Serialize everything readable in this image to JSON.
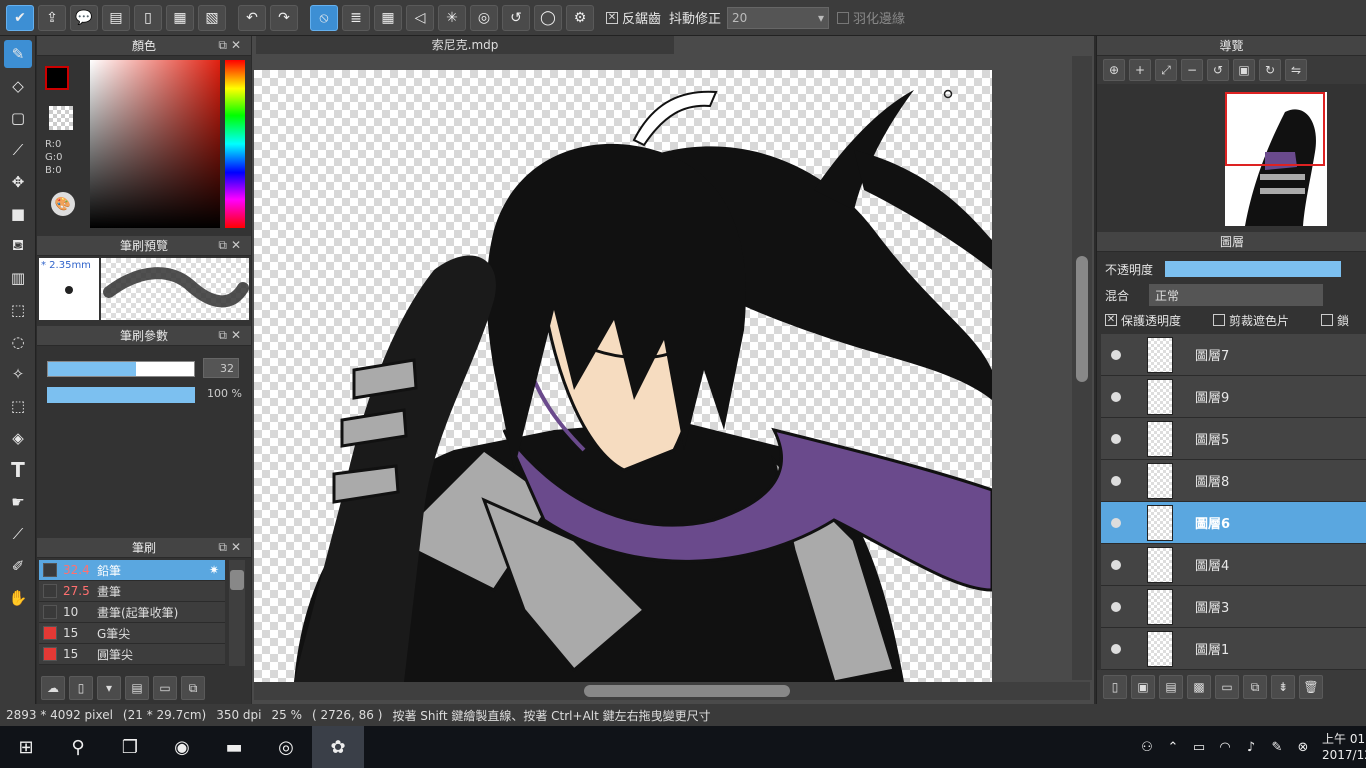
{
  "toolbar": {
    "antialias_label": "反鋸齒",
    "stabilizer_label": "抖動修正",
    "stabilizer_value": "20",
    "feather_label": "羽化邊緣"
  },
  "panels": {
    "color_title": "顏色",
    "rgb": {
      "r": "R:0",
      "g": "G:0",
      "b": "B:0"
    },
    "brush_preview_title": "筆刷預覽",
    "brush_size_text": "* 2.35mm",
    "brush_params_title": "筆刷參數",
    "size_value": "32",
    "size_fill": 0.6,
    "opacity_value": "100 %",
    "opacity_fill": 1.0,
    "brush_title": "筆刷",
    "brushes": [
      {
        "size": "32.4",
        "name": "鉛筆",
        "color": "#3a3a3a",
        "selected": true,
        "red_size": true
      },
      {
        "size": "27.5",
        "name": "畫筆",
        "color": "#3a3a3a",
        "selected": false,
        "red_size": true
      },
      {
        "size": "10",
        "name": "畫筆(起筆收筆)",
        "color": "#3a3a3a",
        "selected": false,
        "red_size": false
      },
      {
        "size": "15",
        "name": "G筆尖",
        "color": "#e53935",
        "selected": false,
        "red_size": false
      },
      {
        "size": "15",
        "name": "圓筆尖",
        "color": "#e53935",
        "selected": false,
        "red_size": false
      }
    ]
  },
  "canvas": {
    "tab_title": "索尼克.mdp"
  },
  "right": {
    "navigator_title": "導覽",
    "layers_title": "圖層",
    "opacity_label": "不透明度",
    "blend_label": "混合",
    "blend_value": "正常",
    "protect_alpha": "保護透明度",
    "clipping": "剪裁遮色片",
    "lock": "鎖",
    "layers": [
      {
        "name": "圖層7",
        "selected": false
      },
      {
        "name": "圖層9",
        "selected": false
      },
      {
        "name": "圖層5",
        "selected": false
      },
      {
        "name": "圖層8",
        "selected": false
      },
      {
        "name": "圖層6",
        "selected": true
      },
      {
        "name": "圖層4",
        "selected": false
      },
      {
        "name": "圖層3",
        "selected": false
      },
      {
        "name": "圖層1",
        "selected": false
      }
    ]
  },
  "status": {
    "pixels": "2893 * 4092 pixel",
    "size_cm": "(21 * 29.7cm)",
    "dpi": "350 dpi",
    "zoom": "25 %",
    "coords": "( 2726, 86 )",
    "hint": "按著 Shift 鍵繪製直線、按著 Ctrl+Alt 鍵左右拖曳變更尺寸"
  },
  "taskbar": {
    "clock_time": "上午 01:",
    "clock_date": "2017/12"
  }
}
